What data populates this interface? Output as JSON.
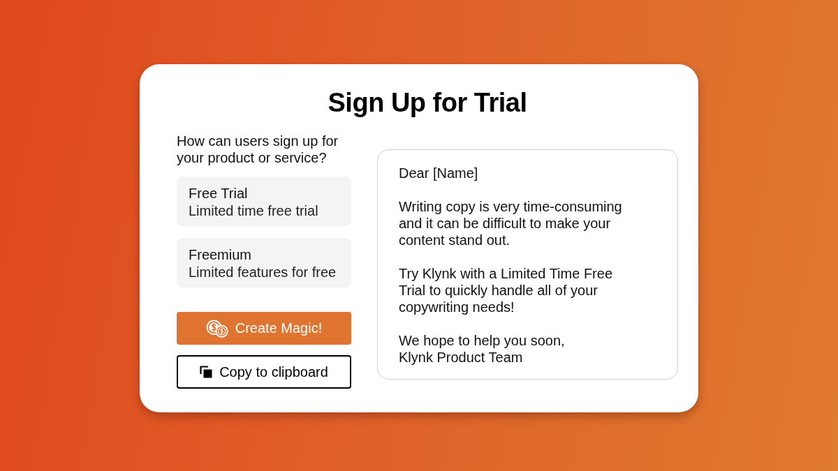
{
  "title": "Sign Up for Trial",
  "question": "How can users sign up for your product or service?",
  "options": [
    {
      "title": "Free Trial",
      "description": "Limited time free trial",
      "selected": false
    },
    {
      "title": "Freemium",
      "description": "Limited features for free",
      "selected": false
    }
  ],
  "buttons": [
    {
      "kind": "primary",
      "label": "Create Magic!"
    },
    {
      "kind": "outline",
      "label": "Copy to clipboard"
    }
  ],
  "letter": {
    "paragraphs": [
      {
        "lines": [
          "Dear [Name]"
        ]
      },
      {
        "lines": [
          "Writing copy is very time-consuming",
          "and it can be difficult to make your",
          "content stand out."
        ]
      },
      {
        "lines": [
          "Try Klynk with a Limited Time Free",
          "Trial to quickly handle all of your",
          "copywriting needs!"
        ]
      },
      {
        "lines": [
          "We hope to help you soon,",
          "Klynk Product Team"
        ]
      }
    ]
  }
}
